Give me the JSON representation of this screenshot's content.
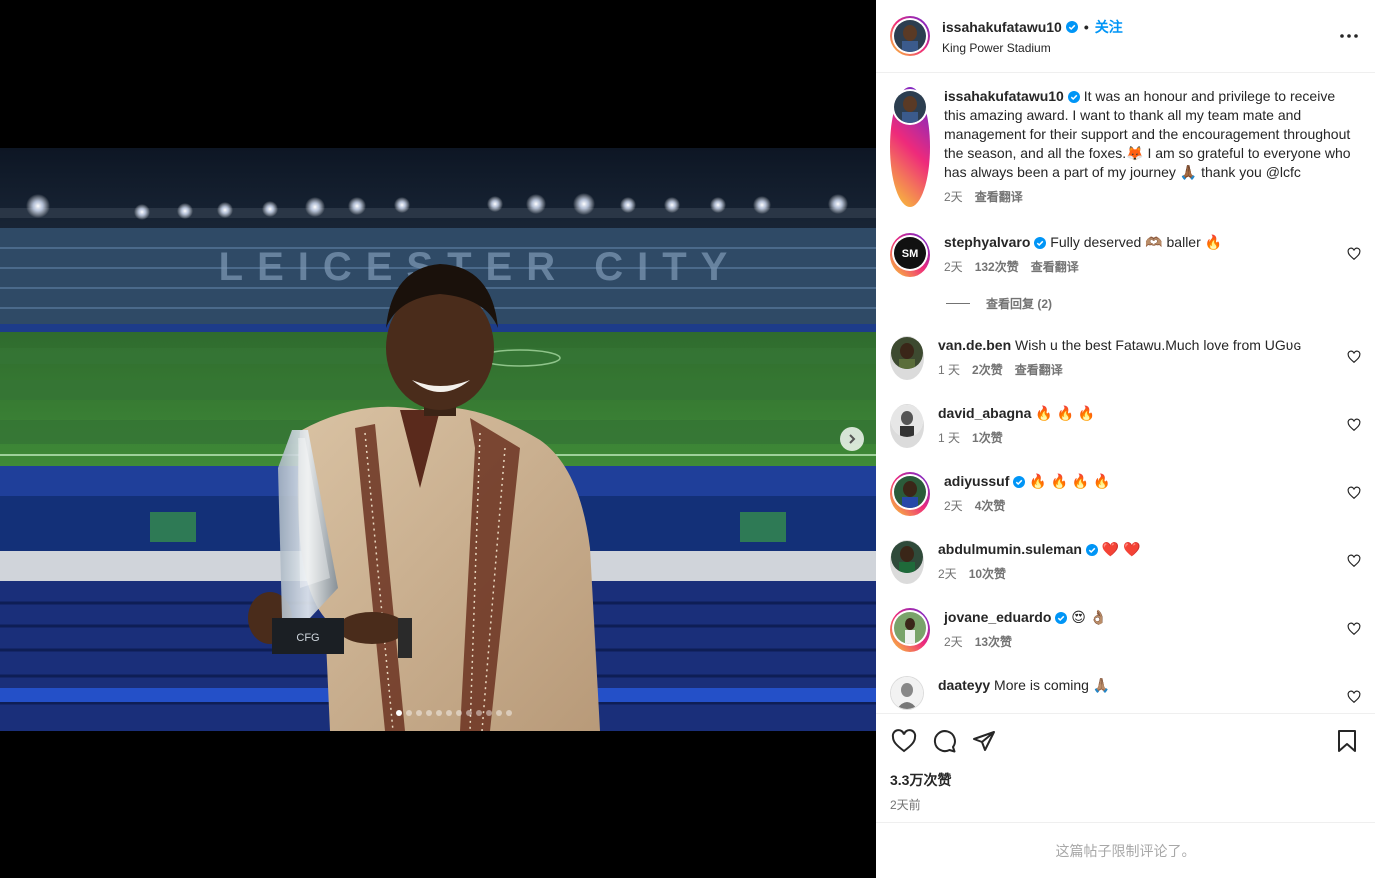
{
  "header": {
    "username": "issahakufatawu10",
    "separator": "•",
    "follow_label": "关注",
    "location": "King Power Stadium"
  },
  "photo": {
    "stand_lettering": "LEICESTER CITY",
    "trophy_text": "CFG"
  },
  "caption": {
    "username": "issahakufatawu10",
    "text": "It was an honour and privilege to receive this amazing award. I want to thank all my team mate and management for their support and the encouragement throughout the season, and all the foxes.🦊 I am so grateful to everyone who has always been a part of my journey 🙏🏾 thank you @lcfc",
    "time": "2天",
    "translate": "查看翻译"
  },
  "comments": [
    {
      "username": "stephyalvaro",
      "verified": true,
      "text": "Fully deserved 🫶🏽 baller 🔥",
      "time": "2天",
      "likes": "132次赞",
      "translate": "查看翻译",
      "avatar_text": "SM",
      "view_replies": "查看回复 (2)"
    },
    {
      "username": "van.de.ben",
      "verified": false,
      "text": "Wish u the best Fatawu.Much love from UGʋɢ",
      "time": "1 天",
      "likes": "2次赞",
      "translate": "查看翻译"
    },
    {
      "username": "david_abagna",
      "verified": false,
      "text": "🔥 🔥 🔥",
      "time": "1 天",
      "likes": "1次赞"
    },
    {
      "username": "adiyussuf",
      "verified": true,
      "text": "🔥 🔥 🔥 🔥",
      "time": "2天",
      "likes": "4次赞"
    },
    {
      "username": "abdulmumin.suleman",
      "verified": true,
      "text": "❤️ ❤️",
      "time": "2天",
      "likes": "10次赞"
    },
    {
      "username": "jovane_eduardo",
      "verified": true,
      "text": "😍 👌🏽",
      "time": "2天",
      "likes": "13次赞"
    },
    {
      "username": "daateyy",
      "verified": false,
      "text": "More is coming 🙏🏽"
    }
  ],
  "footer": {
    "likes": "3.3万次赞",
    "ago": "2天前",
    "comments_limited": "这篇帖子限制评论了。"
  },
  "colors": {
    "accent": "#0095f6",
    "verified": "#0095f6",
    "text": "#262626",
    "muted": "#737373"
  }
}
